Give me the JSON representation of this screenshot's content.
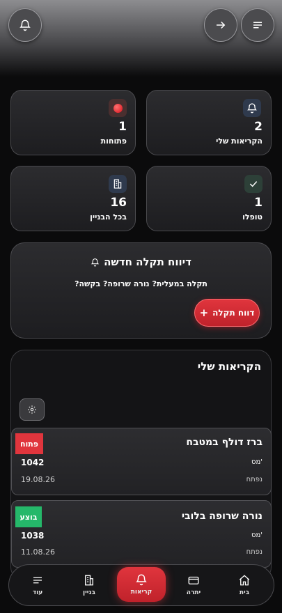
{
  "stats": [
    {
      "value": "2",
      "label": "הקריאות שלי",
      "icon": "bell-icon"
    },
    {
      "value": "1",
      "label": "פתוחות",
      "icon": "red-dot-icon"
    },
    {
      "value": "1",
      "label": "טופלו",
      "icon": "check-icon"
    },
    {
      "value": "16",
      "label": "בכל הבניין",
      "icon": "building-icon"
    }
  ],
  "report": {
    "title": "דיווח תקלה חדשה",
    "subtitle": "תקלה במעלית? נורה שרופה? בקשה?",
    "button_label": "דווח תקלה",
    "button_icon": "plus-icon"
  },
  "my_calls": {
    "title": "הקריאות שלי",
    "filter_icon": "gear-icon",
    "items": [
      {
        "title": "ברז דולף במטבח",
        "status": "פתוח",
        "status_color": "#e0353d",
        "no_label": "מס'",
        "no": "1042",
        "date_label": "נפתח",
        "date": "19.08.26"
      },
      {
        "title": "נורה שרופה בלובי",
        "status": "בוצע",
        "status_color": "#25b86a",
        "no_label": "מס'",
        "no": "1038",
        "date_label": "נפתח",
        "date": "11.08.26"
      }
    ]
  },
  "nav": [
    {
      "label": "בית",
      "icon": "home-icon"
    },
    {
      "label": "יתרה",
      "icon": "wallet-icon"
    },
    {
      "label": "קריאות",
      "icon": "bell-icon",
      "active": true
    },
    {
      "label": "בניין",
      "icon": "building-icon"
    },
    {
      "label": "עוד",
      "icon": "menu-icon"
    }
  ],
  "colors": {
    "accent": "#e0353d",
    "success": "#25b86a"
  }
}
